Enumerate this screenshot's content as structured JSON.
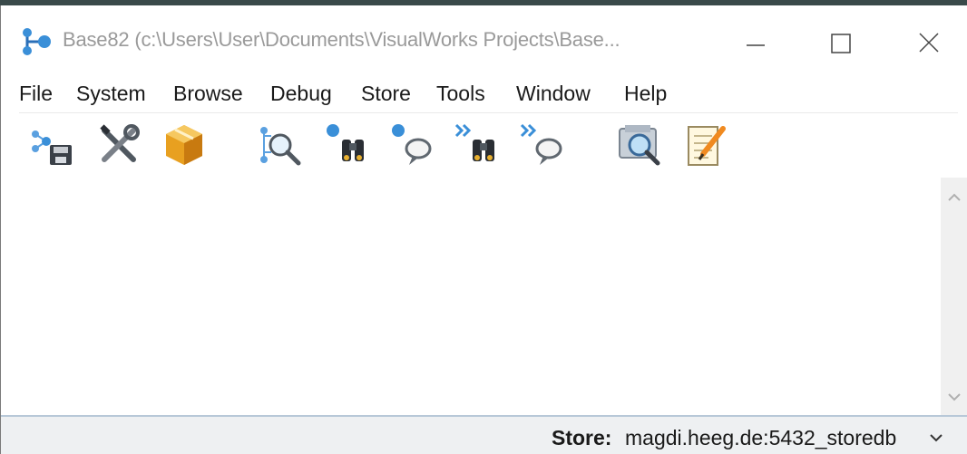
{
  "window": {
    "title": "Base82 (c:\\Users\\User\\Documents\\VisualWorks Projects\\Base...",
    "app_icon": "molecule-app-icon",
    "controls": [
      "minimize-icon",
      "maximize-icon",
      "close-icon"
    ]
  },
  "menu": {
    "items": [
      "File",
      "System",
      "Browse",
      "Debug",
      "Store",
      "Tools",
      "Window",
      "Help"
    ]
  },
  "toolbar": {
    "tools": [
      "save-image-icon",
      "settings-tools-icon",
      "parcel-package-icon",
      "browse-search-icon",
      "find-class-binoculars-icon",
      "find-message-icon",
      "next-class-binoculars-icon",
      "next-message-icon",
      "inspect-magnify-icon",
      "workspace-notepad-icon"
    ]
  },
  "status": {
    "store_label": "Store:",
    "store_value": "magdi.heeg.de:5432_storedb"
  },
  "colors": {
    "accent_blue": "#3a8fd8",
    "status_bg": "#eef0f2",
    "title_text": "#9a9a9a"
  }
}
